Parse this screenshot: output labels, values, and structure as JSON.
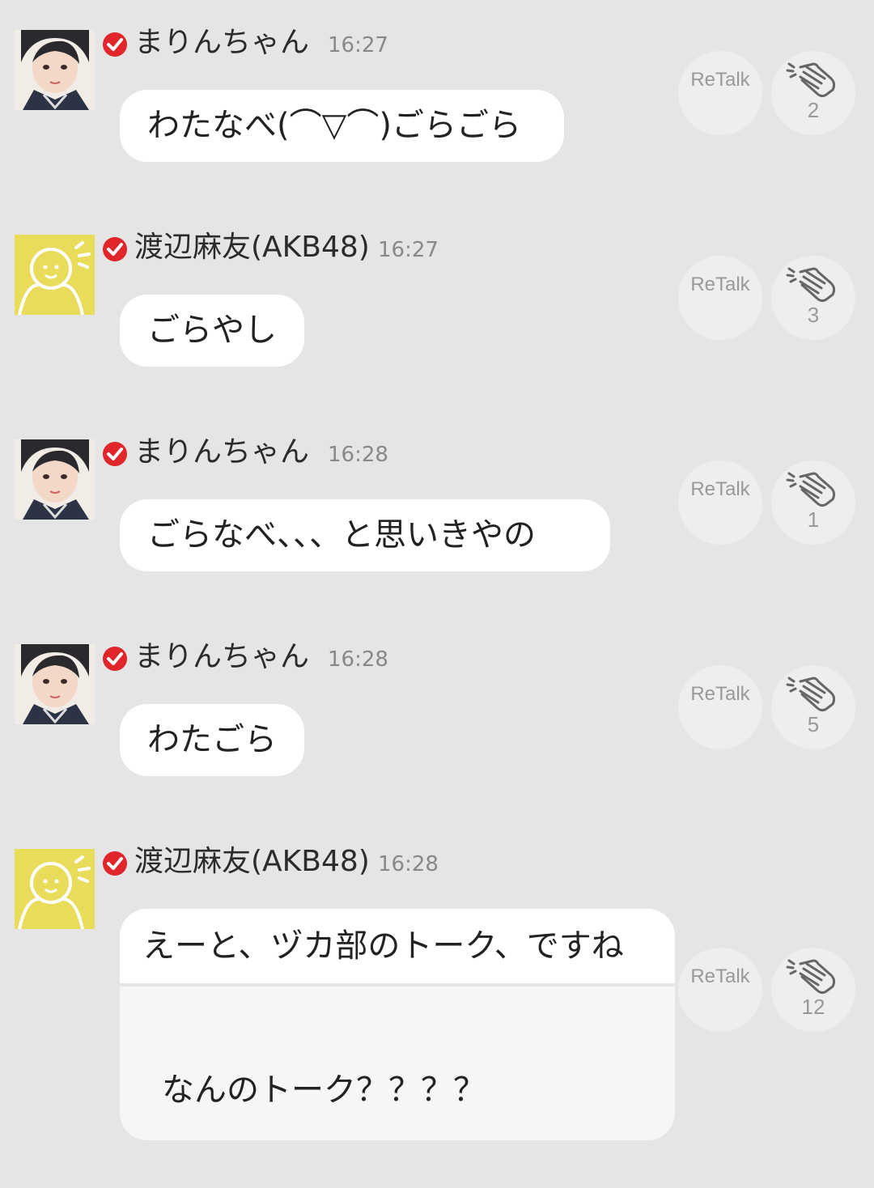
{
  "messages": [
    {
      "author": "まりんちゃん",
      "time": "16:27",
      "text": "わたなべ(⌒▽⌒)ごらごら",
      "retalk_label": "ReTalk",
      "claps": "2",
      "avatar": "photo"
    },
    {
      "author": "渡辺麻友(AKB48)",
      "time": "16:27",
      "text": "ごらやし",
      "retalk_label": "ReTalk",
      "claps": "3",
      "avatar": "default-yellow"
    },
    {
      "author": "まりんちゃん",
      "time": "16:28",
      "text": "ごらなべ、、、と思いきやの",
      "retalk_label": "ReTalk",
      "claps": "1",
      "avatar": "photo"
    },
    {
      "author": "まりんちゃん",
      "time": "16:28",
      "text": "わたごら",
      "retalk_label": "ReTalk",
      "claps": "5",
      "avatar": "photo"
    },
    {
      "author": "渡辺麻友(AKB48)",
      "time": "16:28",
      "quoted_text": "えーと、ヅカ部のトーク、ですね",
      "text": "なんのトーク？？？？",
      "retalk_label": "ReTalk",
      "claps": "12",
      "avatar": "default-yellow"
    }
  ],
  "icons": {
    "verified": "verified-check-icon",
    "clap": "clap-icon"
  },
  "colors": {
    "background": "#e5e5e5",
    "bubble": "#ffffff",
    "verified_red": "#e0262b",
    "default_avatar_yellow": "#e8dc5a",
    "button_bg": "#eeeeee",
    "button_text": "#999999"
  }
}
